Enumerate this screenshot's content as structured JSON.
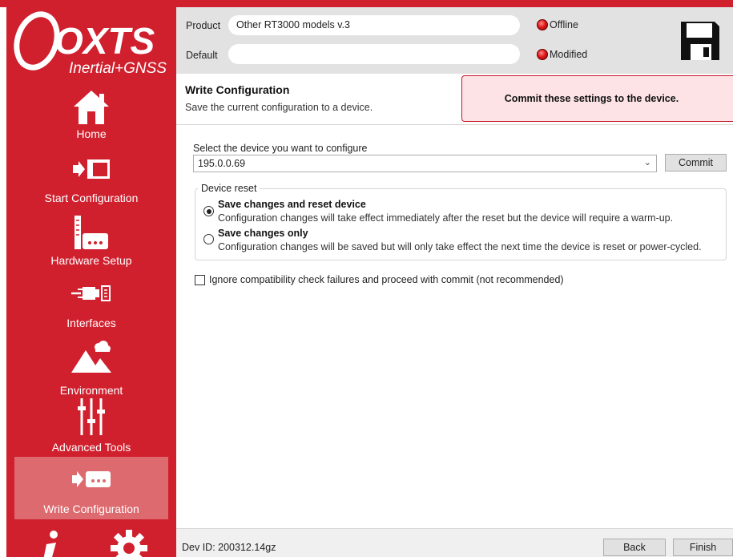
{
  "brand": {
    "logo_text": "OXTS",
    "logo_sub": "Inertial+GNSS",
    "color": "#d0202e"
  },
  "header": {
    "product_label": "Product",
    "product_value": "Other RT3000 models v.3",
    "default_label": "Default",
    "default_value": "",
    "status_offline": "Offline",
    "status_modified": "Modified",
    "save_icon": "floppy-disk-icon"
  },
  "sidebar": {
    "items": [
      {
        "label": "Home",
        "icon": "house-icon"
      },
      {
        "label": "Start Configuration",
        "icon": "arrow-window-icon"
      },
      {
        "label": "Hardware Setup",
        "icon": "ruler-device-icon"
      },
      {
        "label": "Interfaces",
        "icon": "plug-icon"
      },
      {
        "label": "Environment",
        "icon": "mountains-cloud-icon"
      },
      {
        "label": "Advanced Tools",
        "icon": "sliders-icon"
      },
      {
        "label": "Write Configuration",
        "icon": "arrow-device-icon"
      }
    ],
    "bottom_icons": [
      "info-icon",
      "gear-icon"
    ]
  },
  "page": {
    "title": "Write Configuration",
    "subtitle": "Save the current configuration to a device.",
    "hint": "Commit these settings to the device."
  },
  "device": {
    "select_label": "Select the device you want to configure",
    "selected": "195.0.0.69",
    "commit_label": "Commit"
  },
  "reset": {
    "group_title": "Device reset",
    "options": [
      {
        "title": "Save changes and reset device",
        "desc": "Configuration changes will take effect immediately after the reset but the device will require a warm-up.",
        "selected": true
      },
      {
        "title": "Save changes only",
        "desc": "Configuration changes will be saved but will only take effect the next time the device is reset or power-cycled.",
        "selected": false
      }
    ]
  },
  "ignore_check": {
    "label": "Ignore compatibility check failures and proceed with commit (not recommended)",
    "checked": false
  },
  "footer": {
    "dev_id": "Dev ID: 200312.14gz",
    "back_label": "Back",
    "finish_label": "Finish"
  }
}
